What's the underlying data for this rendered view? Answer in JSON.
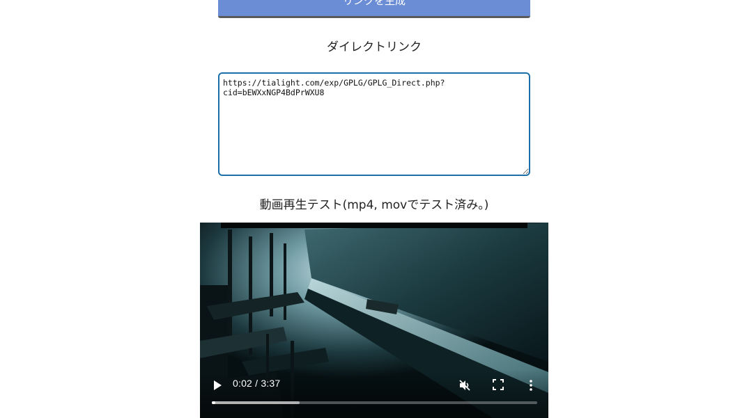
{
  "generate_button": {
    "label": "リンクを生成"
  },
  "direct_link": {
    "heading": "ダイレクトリンク",
    "textarea_value": "https://tialight.com/exp/GPLG/GPLG_Direct.php?cid=bEWXxNGP4BdPrWXU8"
  },
  "video_test": {
    "heading": "動画再生テスト(mp4, movでテスト済み。)",
    "player": {
      "current_time": "0:02",
      "duration": "3:37",
      "time_text": "0:02 / 3:37",
      "muted": true,
      "played_fraction": 0.01,
      "buffered_fraction": 0.27,
      "icons": {
        "play": "play-icon",
        "mute": "volume-muted-icon",
        "fullscreen": "fullscreen-icon",
        "more": "more-vertical-icon"
      }
    }
  }
}
